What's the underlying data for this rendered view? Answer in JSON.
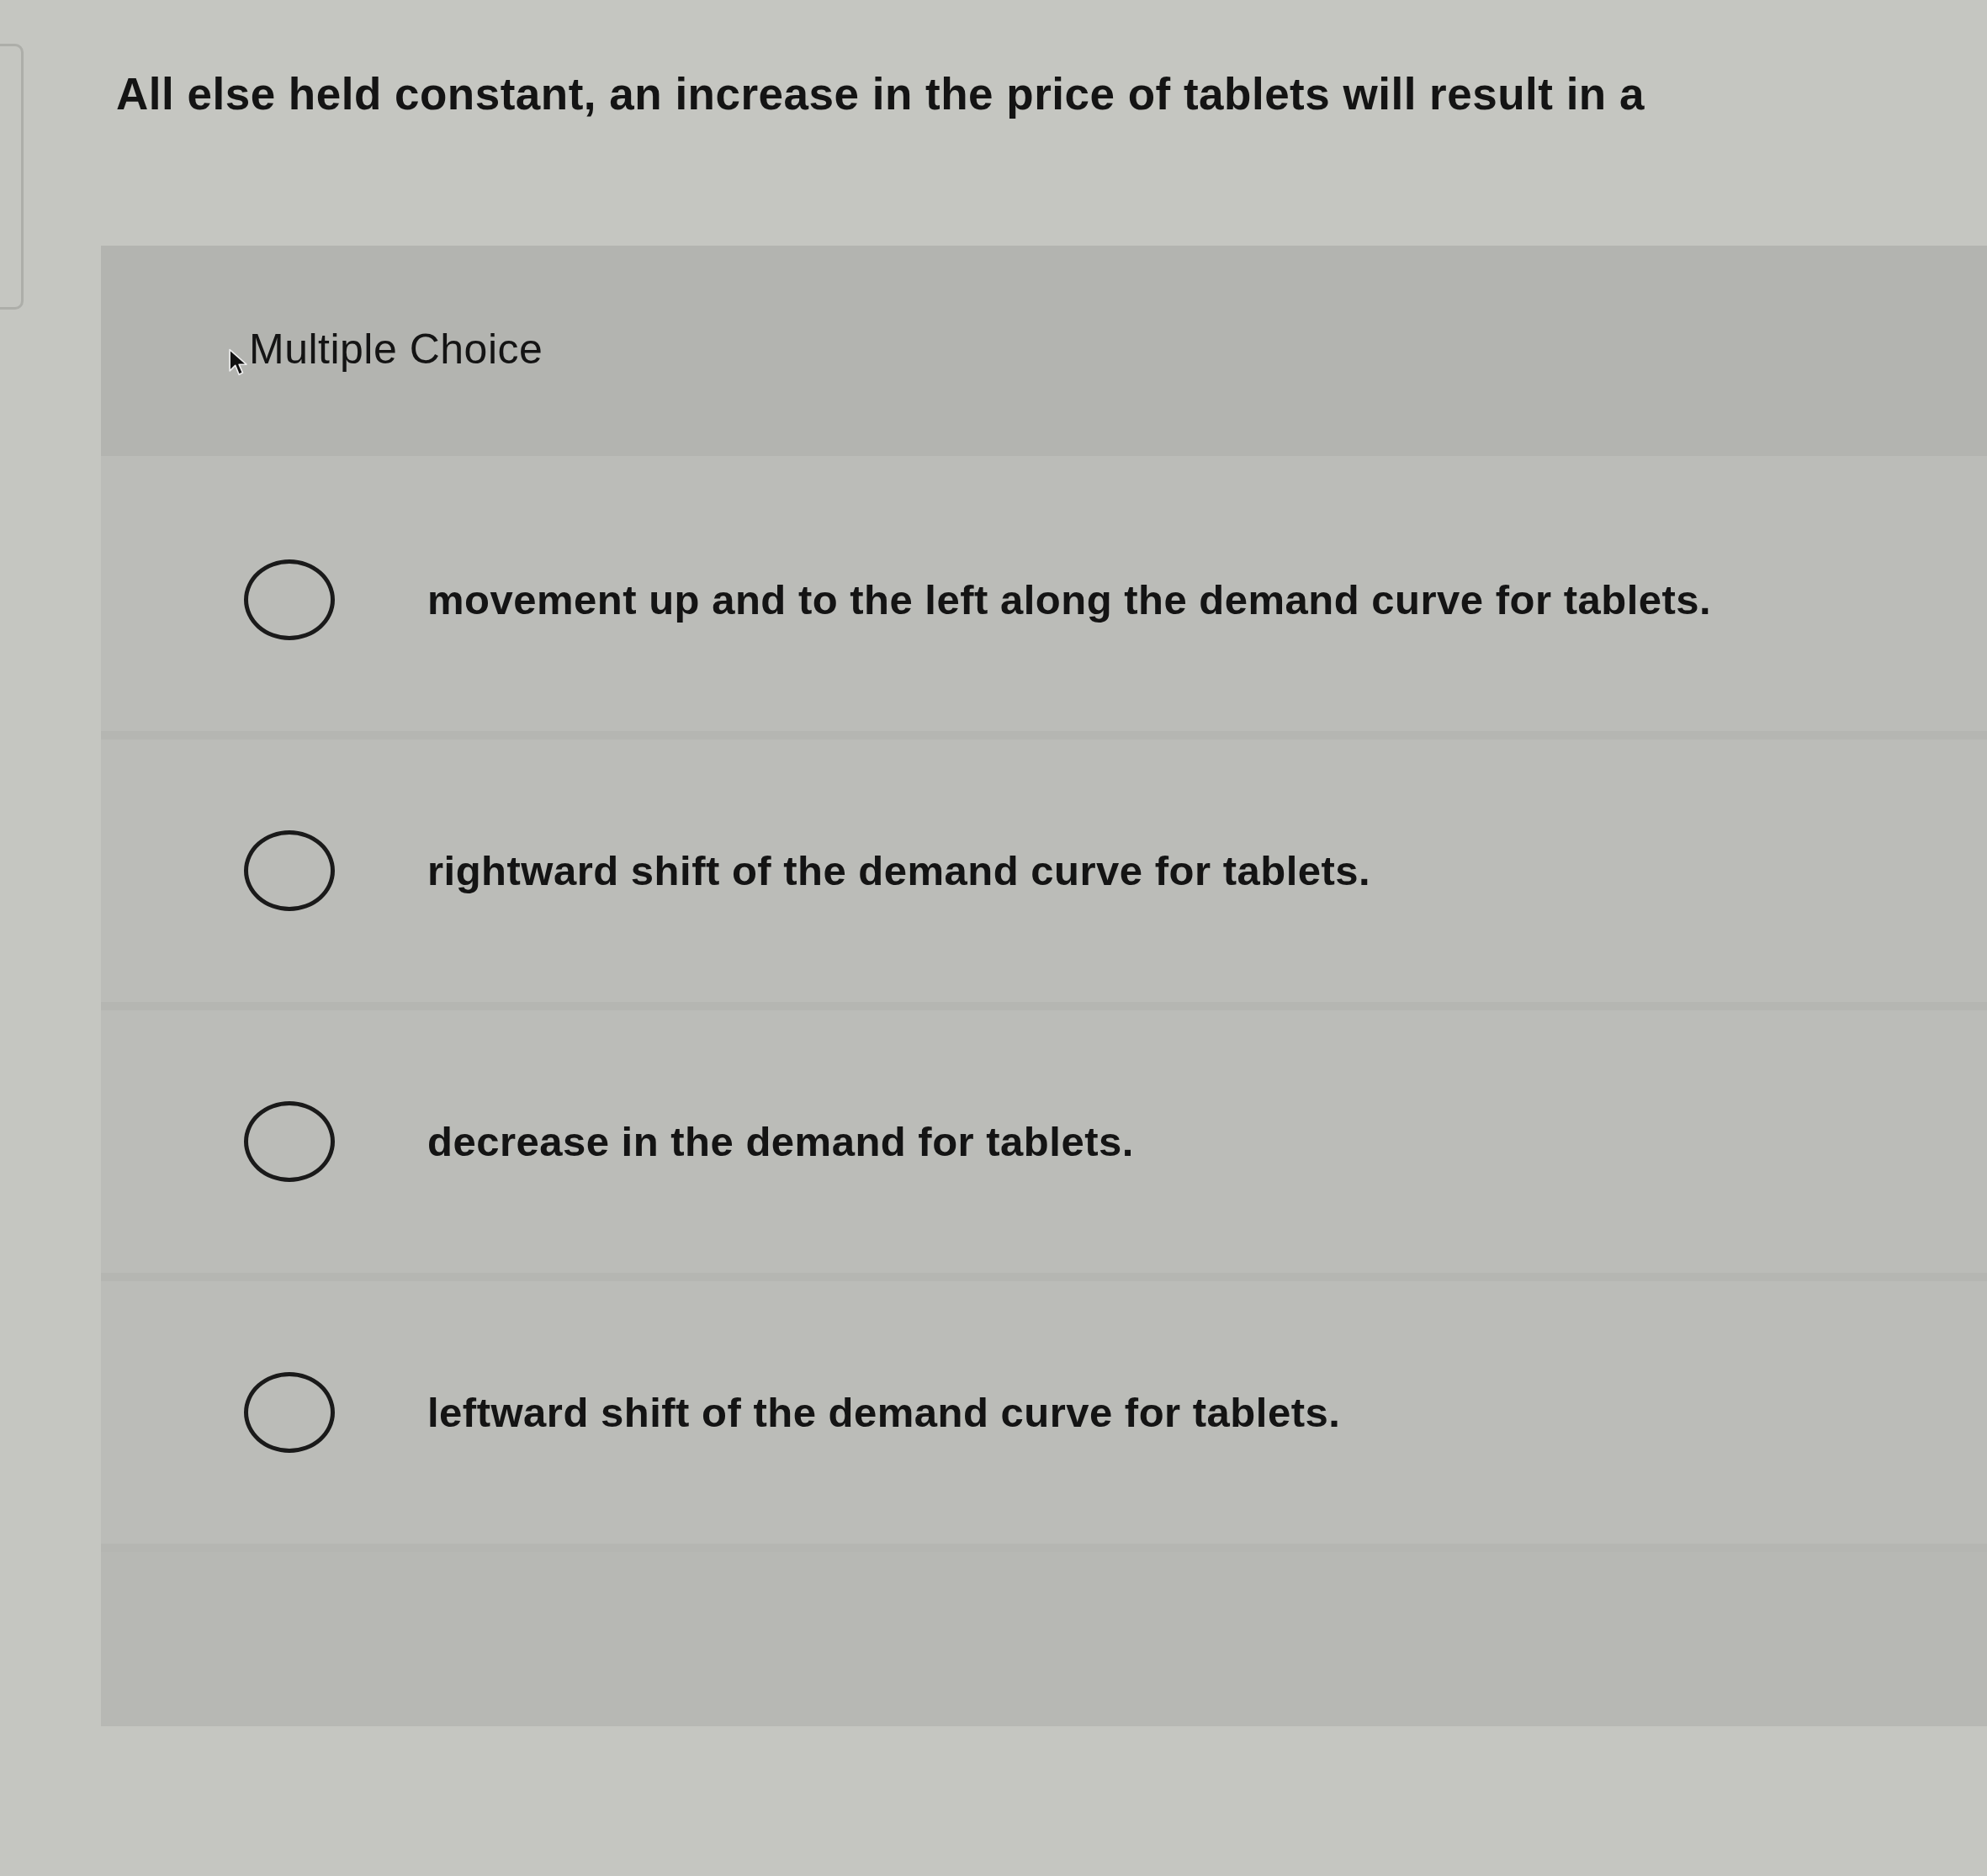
{
  "question": {
    "text": "All else held constant, an increase in the price of tablets will result in a"
  },
  "question_type": "Multiple Choice",
  "options": [
    {
      "label": "movement up and to the left along the demand curve for tablets.",
      "selected": false
    },
    {
      "label": "rightward shift of the demand curve for tablets.",
      "selected": false
    },
    {
      "label": "decrease in the demand for tablets.",
      "selected": false
    },
    {
      "label": "leftward shift of the demand curve for tablets.",
      "selected": false
    }
  ]
}
